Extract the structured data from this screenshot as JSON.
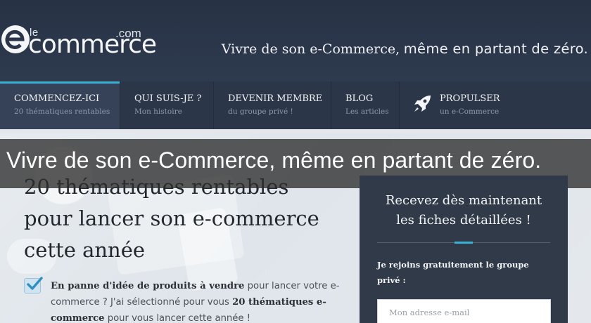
{
  "header": {
    "logo": {
      "le": "le",
      "commerce": "commerce",
      "com": ".com"
    },
    "tagline_part1": "Vivre de son e-Commerce,",
    "tagline_part2": "même en partant de zéro."
  },
  "nav": {
    "items": [
      {
        "label": "COMMENCEZ-ICI",
        "sub": "20 thématiques rentables"
      },
      {
        "label": "QUI SUIS-JE ?",
        "sub": "Mon histoire"
      },
      {
        "label": "DEVENIR MEMBRE",
        "sub": "du groupe privé !"
      },
      {
        "label": "BLOG",
        "sub": "Les articles"
      },
      {
        "label": "PROPULSER",
        "sub": "un e-Commerce",
        "icon": "rocket-icon"
      }
    ],
    "active_index": 0
  },
  "banner": {
    "text": "Vivre de son e-Commerce, même en partant de zéro."
  },
  "hero": {
    "headline": [
      "20 thématiques rentables",
      "pour lancer son e-commerce",
      "cette année"
    ],
    "paragraph": {
      "b1": "En panne d'idée de produits à vendre",
      "t1": " pour lancer votre e-commerce ? J'ai sélectionné pour vous ",
      "b2": "20 thématiques e-commerce",
      "t2": " pour vous lancer cette année !"
    }
  },
  "signup": {
    "title_line1": "Recevez dès maintenant",
    "title_line2": "les fiches détaillées !",
    "text": "Je rejoins gratuitement le groupe privé :",
    "email_placeholder": "Mon adresse e-mail"
  },
  "colors": {
    "header_bg": "#2b3649",
    "accent": "#3ab0d6",
    "signup_bg": "#313a48"
  }
}
